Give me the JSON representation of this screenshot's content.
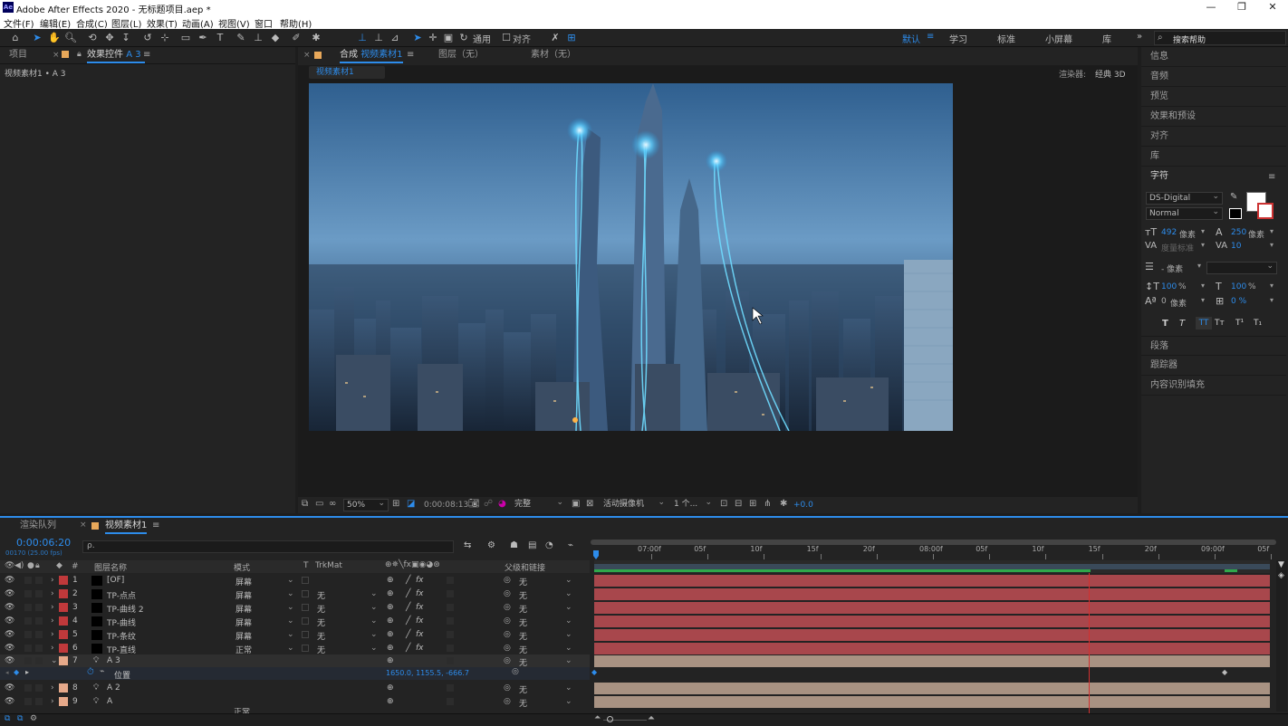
{
  "app": {
    "title": "Adobe After Effects 2020 - 无标题项目.aep *",
    "logo": "Ae"
  },
  "window_controls": {
    "minimize": "—",
    "maximize": "❐",
    "close": "✕"
  },
  "menu": [
    "文件(F)",
    "编辑(E)",
    "合成(C)",
    "图层(L)",
    "效果(T)",
    "动画(A)",
    "视图(V)",
    "窗口",
    "帮助(H)"
  ],
  "toolbar": {
    "snap_label": "通用",
    "align_label": "对齐",
    "workspaces": [
      "默认",
      "学习",
      "标准",
      "小屏幕",
      "库"
    ],
    "active_workspace": "默认",
    "menu_icon": "≡",
    "overflow_icon": "»",
    "search_placeholder": "搜索帮助"
  },
  "left_panel": {
    "tab_project": "项目",
    "tab_effects": "效果控件",
    "tab_effects_layer": "A 3",
    "breadcrumb": "视频素材1 • A 3"
  },
  "comp_panel": {
    "tab_comp_prefix": "合成",
    "tab_comp_name": "视频素材1",
    "tab_layer": "图层（无）",
    "tab_footage": "素材（无）",
    "sub_tab": "视频素材1",
    "renderer_label": "渲染器:",
    "renderer_value": "经典 3D"
  },
  "viewer_footer": {
    "zoom": "50%",
    "timecode": "0:00:08:13",
    "resolution": "完整",
    "camera": "活动摄像机",
    "views": "1 个...",
    "exposure": "+0.0"
  },
  "right_panel": {
    "items": [
      "信息",
      "音频",
      "预览",
      "效果和预设",
      "对齐",
      "库"
    ],
    "character_title": "字符",
    "font": "DS-Digital",
    "style": "Normal",
    "size_value": "492",
    "size_unit": "像素",
    "leading_value": "250",
    "leading_unit": "像素",
    "kerning": "度量标准",
    "tracking": "10",
    "stroke_label": "- 像素",
    "vscale": "100",
    "hscale": "100",
    "baseline_value": "0",
    "baseline_unit": "像素",
    "tsume": "0 %",
    "percent": "%",
    "style_buttons": [
      "T",
      "T",
      "TT",
      "Tт",
      "T¹",
      "T₁"
    ],
    "bottom_items": [
      "段落",
      "跟踪器",
      "内容识别填充"
    ]
  },
  "timeline": {
    "tab_render": "渲染队列",
    "tab_comp": "视频素材1",
    "current_time": "0:00:06:20",
    "frame_info": "00170 (25.00 fps)",
    "search_placeholder": "ρ.",
    "columns": {
      "num": "#",
      "name": "图层名称",
      "mode": "模式",
      "t": "T",
      "trkmat": "TrkMat",
      "parent": "父级和链接"
    },
    "ruler": [
      "07:00f",
      "05f",
      "10f",
      "15f",
      "20f",
      "08:00f",
      "05f",
      "10f",
      "15f",
      "20f",
      "09:00f",
      "05f"
    ],
    "layers": [
      {
        "num": "1",
        "name": "[OF]",
        "mode": "屏幕",
        "trkmat": "",
        "parent": "无",
        "color": "#c0393b",
        "type": "solid"
      },
      {
        "num": "2",
        "name": "TP-点点",
        "mode": "屏幕",
        "trkmat": "无",
        "parent": "无",
        "color": "#c0393b",
        "type": "solid"
      },
      {
        "num": "3",
        "name": "TP-曲线 2",
        "mode": "屏幕",
        "trkmat": "无",
        "parent": "无",
        "color": "#c0393b",
        "type": "solid"
      },
      {
        "num": "4",
        "name": "TP-曲线",
        "mode": "屏幕",
        "trkmat": "无",
        "parent": "无",
        "color": "#c0393b",
        "type": "solid"
      },
      {
        "num": "5",
        "name": "TP-条纹",
        "mode": "屏幕",
        "trkmat": "无",
        "parent": "无",
        "color": "#c0393b",
        "type": "solid"
      },
      {
        "num": "6",
        "name": "TP-直线",
        "mode": "正常",
        "trkmat": "无",
        "parent": "无",
        "color": "#c0393b",
        "type": "solid"
      },
      {
        "num": "7",
        "name": "A 3",
        "mode": "",
        "trkmat": "",
        "parent": "无",
        "color": "#e6a98a",
        "type": "light"
      },
      {
        "num": "8",
        "name": "A 2",
        "mode": "",
        "trkmat": "",
        "parent": "无",
        "color": "#e6a98a",
        "type": "light"
      },
      {
        "num": "9",
        "name": "A",
        "mode": "",
        "trkmat": "",
        "parent": "无",
        "color": "#e6a98a",
        "type": "light"
      }
    ],
    "property": {
      "name": "位置",
      "value": "1650.0, 1155.5, -666.7"
    },
    "partial_row": {
      "mode": "正常"
    }
  },
  "colors": {
    "accent": "#2d8ceb",
    "solid_bar": "#a8474c",
    "light_bar": "#a89282",
    "playhead": "#d23030"
  }
}
